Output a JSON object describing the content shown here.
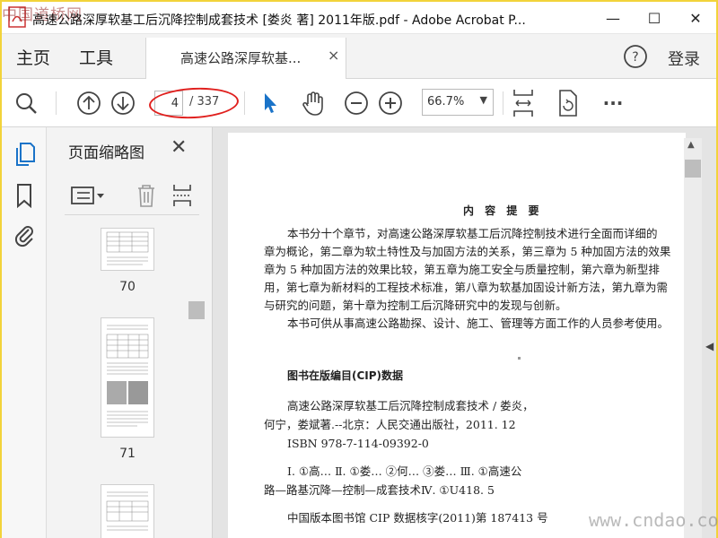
{
  "window": {
    "title": "高速公路深厚软基工后沉降控制成套技术 [娄炎 著] 2011年版.pdf - Adobe Acrobat P...",
    "corner_watermark": "中国道桥网",
    "minimize": "—",
    "maximize": "☐",
    "close": "✕"
  },
  "menu": {
    "home": "主页",
    "tools": "工具",
    "tab_label": "高速公路深厚软基...",
    "tab_close": "×",
    "help": "?",
    "login": "登录"
  },
  "toolbar": {
    "current_page": "4",
    "total_pages": "/ 337",
    "zoom": "66.7%",
    "zoom_arrow": "▼",
    "more": "···"
  },
  "thumbnails": {
    "title": "页面缩略图",
    "close": "✕",
    "pages": [
      "70",
      "71"
    ]
  },
  "handles": {
    "left": "◀",
    "right": "◀",
    "up": "▲"
  },
  "document": {
    "heading": "内 容 提 要",
    "summary_lines": [
      "本书分十个章节，对高速公路深厚软基工后沉降控制技术进行全面而详细的",
      "章为概论，第二章为软土特性及与加固方法的关系，第三章为 5 种加固方法的效果",
      "章为 5 种加固方法的效果比较，第五章为施工安全与质量控制，第六章为新型排",
      "用，第七章为新材料的工程技术标准，第八章为软基加固设计新方法，第九章为需",
      "与研究的问题，第十章为控制工后沉降研究中的发现与创新。",
      "本书可供从事高速公路勘探、设计、施工、管理等方面工作的人员参考使用。"
    ],
    "cip_heading": "图书在版编目(CIP)数据",
    "cip_lines": [
      "高速公路深厚软基工后沉降控制成套技术 / 娄炎，",
      "何宁，娄斌著.--北京：人民交通出版社，2011. 12",
      "ISBN 978-7-114-09392-0",
      "",
      "Ⅰ. ①高… Ⅱ. ①娄… ②何… ③娄… Ⅲ. ①高速公",
      "路—路基沉降—控制—成套技术Ⅳ. ①U418. 5",
      "",
      "中国版本图书馆 CIP 数据核字(2011)第 187413 号"
    ]
  },
  "watermark": "www.cndao.com",
  "colors": {
    "accent_blue": "#1a73c8",
    "annotation_red": "#e0201e"
  }
}
